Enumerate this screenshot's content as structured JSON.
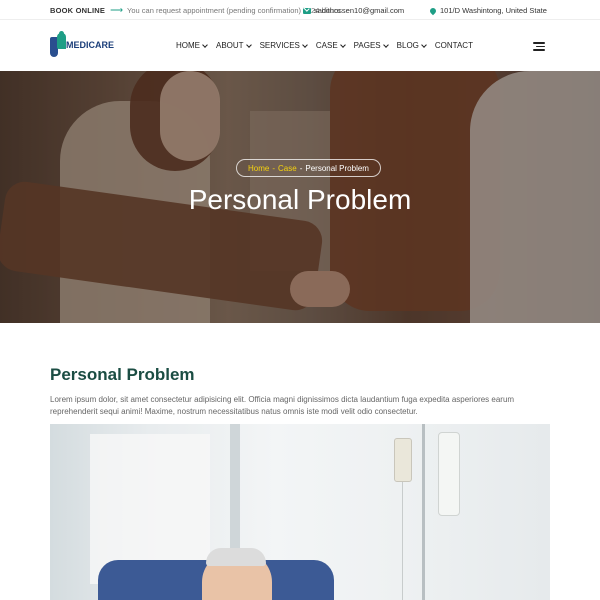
{
  "topbar": {
    "book_label": "BOOK ONLINE",
    "note": "You can request appointment (pending confirmation) in 24 hours",
    "email": "sadithossen10@gmail.com",
    "address": "101/D Washintong, United State"
  },
  "logo": {
    "text": "MEDICARE"
  },
  "nav": {
    "items": [
      {
        "label": "HOME",
        "dropdown": true
      },
      {
        "label": "ABOUT",
        "dropdown": true
      },
      {
        "label": "SERVICES",
        "dropdown": true
      },
      {
        "label": "CASE",
        "dropdown": true
      },
      {
        "label": "PAGES",
        "dropdown": true
      },
      {
        "label": "BLOG",
        "dropdown": true
      },
      {
        "label": "CONTACT",
        "dropdown": false
      }
    ]
  },
  "hero": {
    "breadcrumb": {
      "home": "Home",
      "case": "Case",
      "current": "Personal Problem"
    },
    "title": "Personal Problem"
  },
  "content": {
    "title": "Personal Problem",
    "paragraph": "Lorem ipsum dolor, sit amet consectetur adipisicing elit. Officia magni dignissimos dicta laudantium fuga expedita asperiores earum reprehenderit sequi animi! Maxime, nostrum necessitatibus natus omnis iste modi velit odio consectetur."
  },
  "colors": {
    "accent": "#1e9e86",
    "brand": "#1b3e7a",
    "breadcrumb_link": "#f5d20f",
    "heading": "#1b4d43"
  }
}
